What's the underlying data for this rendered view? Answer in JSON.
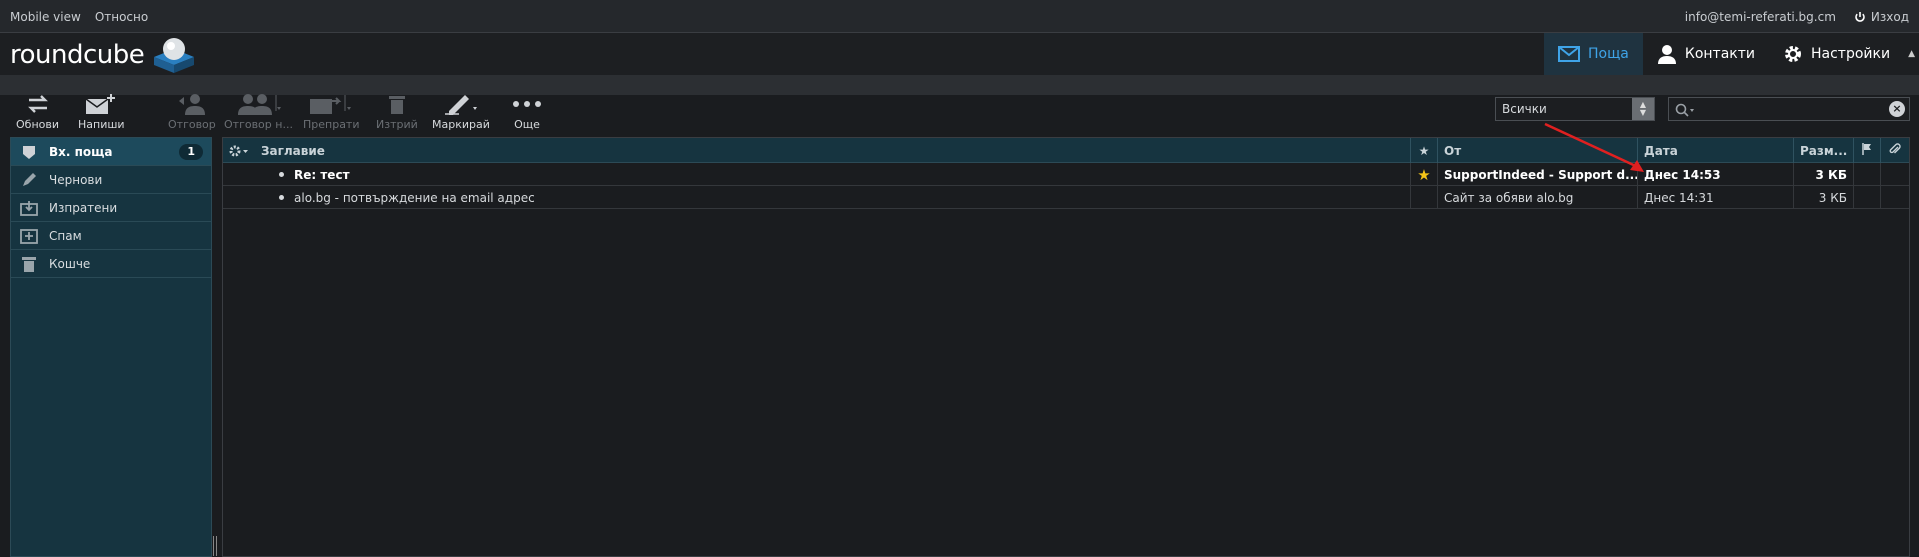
{
  "topbar": {
    "mobile_view": "Mobile view",
    "about": "Относно",
    "user_email": "info@temi-referati.bg.cm",
    "logout": "Изход"
  },
  "logo": {
    "text": "roundcube"
  },
  "nav": {
    "mail": "Поща",
    "contacts": "Контакти",
    "settings": "Настройки"
  },
  "toolbar": {
    "refresh": "Обнови",
    "compose": "Напиши",
    "reply": "Отговор",
    "reply_all": "Отговор н...",
    "forward": "Препрати",
    "delete": "Изтрий",
    "mark": "Маркирай",
    "more": "Още"
  },
  "filter": {
    "selected": "Всички"
  },
  "search": {
    "placeholder": ""
  },
  "folders": [
    {
      "label": "Вх. поща",
      "unread": "1",
      "icon": "inbox-icon"
    },
    {
      "label": "Чернови",
      "icon": "pencil-icon"
    },
    {
      "label": "Изпратени",
      "icon": "sent-icon"
    },
    {
      "label": "Спам",
      "icon": "spam-icon"
    },
    {
      "label": "Кошче",
      "icon": "trash-icon"
    }
  ],
  "list_headers": {
    "subject": "Заглавие",
    "from": "От",
    "date": "Дата",
    "size": "Разм..."
  },
  "messages": [
    {
      "subject": "Re: тест",
      "from": "SupportIndeed - Support d...",
      "date": "Днес 14:53",
      "size": "3 КБ",
      "flagged_star": true,
      "unread": true
    },
    {
      "subject": "alo.bg - потвърждение на email адрес",
      "from": "Сайт за обяви alo.bg",
      "date": "Днес 14:31",
      "size": "3 КБ",
      "flagged_star": false,
      "unread": false
    }
  ],
  "colors": {
    "accent": "#3fa4e8",
    "star": "#f5c518",
    "annotation_arrow": "#e02020"
  }
}
